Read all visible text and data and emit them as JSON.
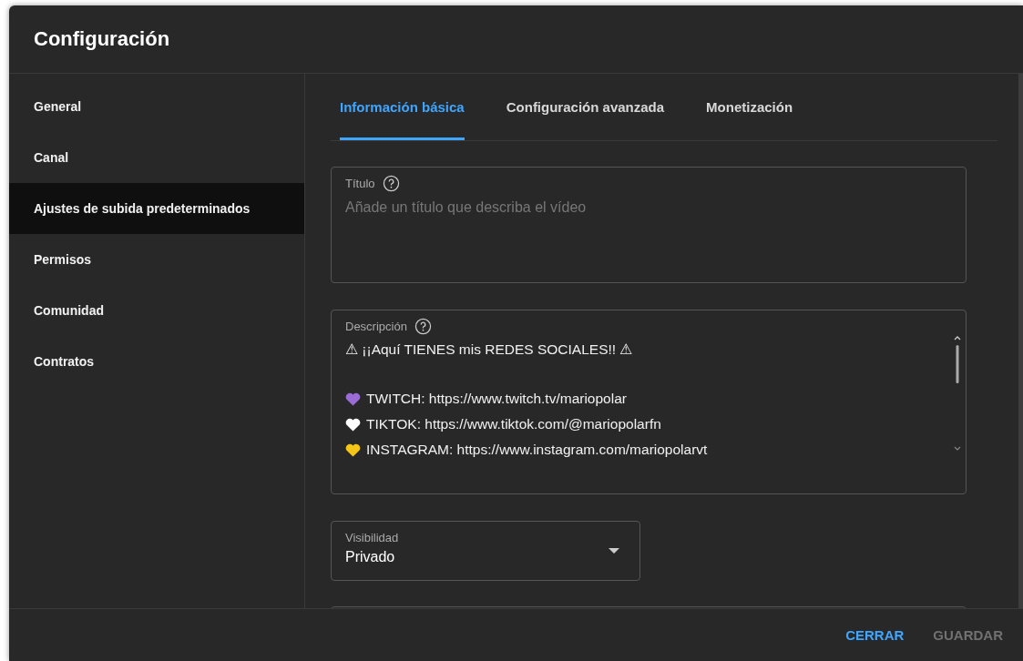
{
  "dialog": {
    "title": "Configuración"
  },
  "sidebar": {
    "items": [
      {
        "label": "General",
        "selected": false
      },
      {
        "label": "Canal",
        "selected": false
      },
      {
        "label": "Ajustes de subida predeterminados",
        "selected": true
      },
      {
        "label": "Permisos",
        "selected": false
      },
      {
        "label": "Comunidad",
        "selected": false
      },
      {
        "label": "Contratos",
        "selected": false
      }
    ]
  },
  "tabs": [
    {
      "label": "Información básica",
      "selected": true
    },
    {
      "label": "Configuración avanzada",
      "selected": false
    },
    {
      "label": "Monetización",
      "selected": false
    }
  ],
  "title_field": {
    "label": "Título",
    "placeholder": "Añade un título que describa el vídeo"
  },
  "description_field": {
    "label": "Descripción",
    "lines": [
      {
        "kind": "heading",
        "text": "⚠ ¡¡Aquí TIENES mis REDES SOCIALES!! ⚠"
      },
      {
        "kind": "link",
        "text": "TWITCH: https://www.twitch.tv/mariopolar",
        "color": "#9b6bd6"
      },
      {
        "kind": "link",
        "text": "TIKTOK: https://www.tiktok.com/@mariopolarfn",
        "color": "#ffffff"
      },
      {
        "kind": "link",
        "text": "INSTAGRAM: https://www.instagram.com/mariopolarvt",
        "color": "#f5c518"
      }
    ]
  },
  "visibility": {
    "label": "Visibilidad",
    "value": "Privado"
  },
  "footer": {
    "buttons": [
      {
        "label": "CERRAR",
        "disabled": false
      },
      {
        "label": "GUARDAR",
        "disabled": true
      }
    ]
  }
}
